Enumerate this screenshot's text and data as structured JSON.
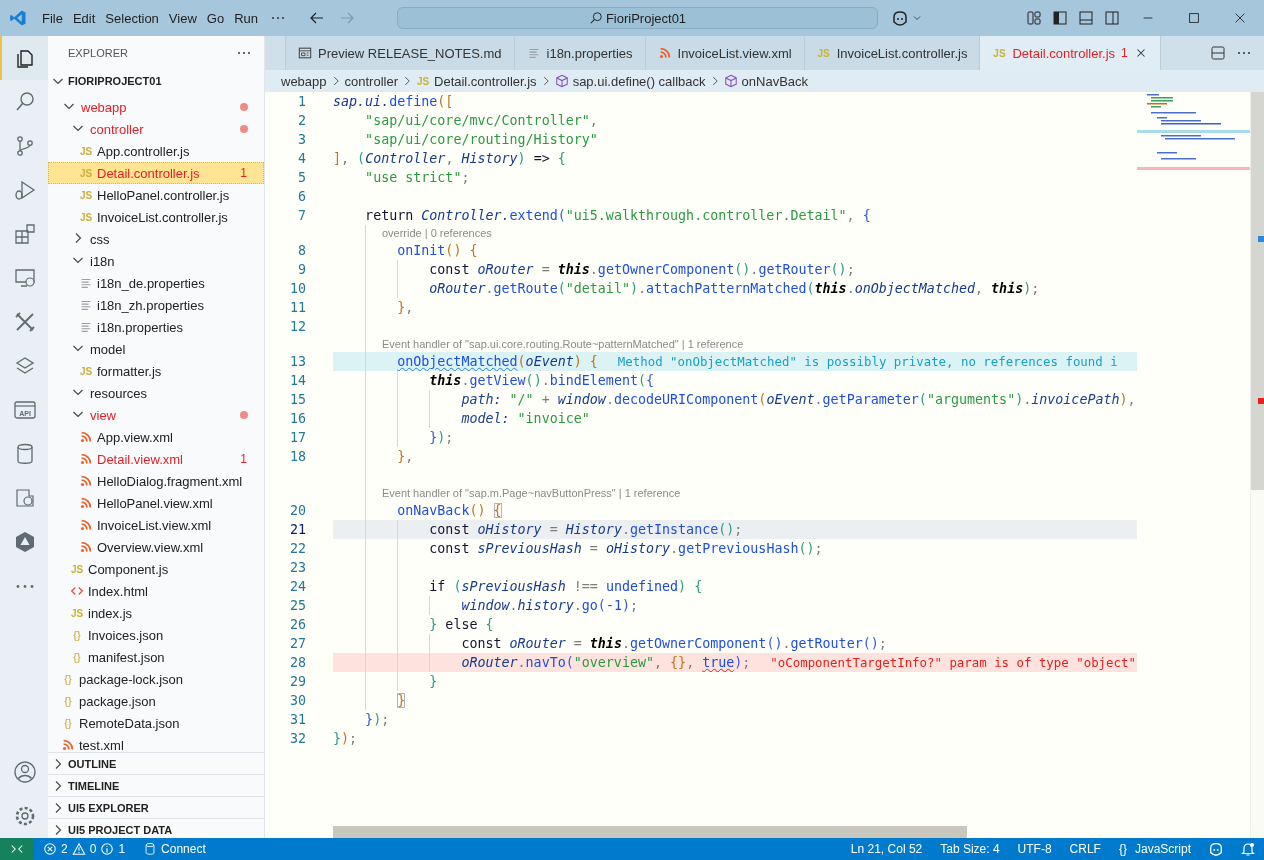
{
  "title_bar": {
    "menu": [
      "File",
      "Edit",
      "Selection",
      "View",
      "Go",
      "Run"
    ],
    "search": "FioriProject01"
  },
  "activity_bar": {
    "items": [
      {
        "kind": "files",
        "selected": true
      },
      {
        "kind": "search",
        "selected": false
      },
      {
        "kind": "source-control",
        "selected": false
      },
      {
        "kind": "run-debug",
        "selected": false
      },
      {
        "kind": "extensions",
        "selected": false
      },
      {
        "kind": "remote",
        "selected": false
      },
      {
        "kind": "tools",
        "selected": false
      },
      {
        "kind": "layers",
        "selected": false
      },
      {
        "kind": "api",
        "label": "API",
        "selected": false
      },
      {
        "kind": "database",
        "selected": false
      },
      {
        "kind": "puzzle",
        "selected": false
      },
      {
        "kind": "hexagon",
        "selected": false
      },
      {
        "kind": "more",
        "selected": false
      }
    ],
    "bottom": [
      {
        "kind": "account",
        "selected": false
      },
      {
        "kind": "settings",
        "selected": false
      }
    ]
  },
  "sidebar": {
    "title": "EXPLORER",
    "project": "FIORIPROJECT01",
    "tree": [
      {
        "name": "webapp",
        "kind": "folder",
        "expanded": true,
        "problem": true,
        "dot": true,
        "selected": false,
        "children": [
          {
            "name": "controller",
            "kind": "folder",
            "expanded": true,
            "problem": true,
            "dot": true,
            "selected": false,
            "children": [
              {
                "name": "App.controller.js",
                "kind": "js",
                "icon": "JS",
                "problem": false,
                "selected": false
              },
              {
                "name": "Detail.controller.js",
                "kind": "js",
                "icon": "JS",
                "problem": true,
                "badge": "1",
                "selected": true
              },
              {
                "name": "HelloPanel.controller.js",
                "kind": "js",
                "icon": "JS",
                "problem": false,
                "selected": false
              },
              {
                "name": "InvoiceList.controller.js",
                "kind": "js",
                "icon": "JS",
                "problem": false,
                "selected": false
              }
            ]
          },
          {
            "name": "css",
            "kind": "folder",
            "expanded": false,
            "problem": false,
            "selected": false
          },
          {
            "name": "i18n",
            "kind": "folder",
            "expanded": true,
            "problem": false,
            "selected": false,
            "children": [
              {
                "name": "i18n_de.properties",
                "kind": "properties",
                "problem": false,
                "selected": false
              },
              {
                "name": "i18n_zh.properties",
                "kind": "properties",
                "problem": false,
                "selected": false
              },
              {
                "name": "i18n.properties",
                "kind": "properties",
                "problem": false,
                "selected": false
              }
            ]
          },
          {
            "name": "model",
            "kind": "folder",
            "expanded": true,
            "problem": false,
            "selected": false,
            "children": [
              {
                "name": "formatter.js",
                "kind": "js",
                "icon": "JS",
                "problem": false,
                "selected": false
              }
            ]
          },
          {
            "name": "resources",
            "kind": "folder",
            "expanded": true,
            "problem": false,
            "selected": false
          },
          {
            "name": "view",
            "kind": "folder",
            "expanded": true,
            "problem": true,
            "dot": true,
            "selected": false,
            "children": [
              {
                "name": "App.view.xml",
                "kind": "xml",
                "problem": false,
                "selected": false
              },
              {
                "name": "Detail.view.xml",
                "kind": "xml",
                "problem": true,
                "badge": "1",
                "selected": false
              },
              {
                "name": "HelloDialog.fragment.xml",
                "kind": "xml",
                "problem": false,
                "selected": false
              },
              {
                "name": "HelloPanel.view.xml",
                "kind": "xml",
                "problem": false,
                "selected": false
              },
              {
                "name": "InvoiceList.view.xml",
                "kind": "xml",
                "problem": false,
                "selected": false
              },
              {
                "name": "Overview.view.xml",
                "kind": "xml",
                "problem": false,
                "selected": false
              }
            ]
          },
          {
            "name": "Component.js",
            "kind": "js",
            "icon": "JS",
            "problem": false,
            "selected": false
          },
          {
            "name": "Index.html",
            "kind": "html",
            "problem": false,
            "selected": false
          },
          {
            "name": "index.js",
            "kind": "js",
            "icon": "JS",
            "problem": false,
            "selected": false
          },
          {
            "name": "Invoices.json",
            "kind": "json",
            "icon": "{}",
            "problem": false,
            "selected": false
          },
          {
            "name": "manifest.json",
            "kind": "json",
            "icon": "{}",
            "problem": false,
            "selected": false
          }
        ]
      },
      {
        "name": "package-lock.json",
        "kind": "json",
        "icon": "{}",
        "problem": false,
        "selected": false
      },
      {
        "name": "package.json",
        "kind": "json",
        "icon": "{}",
        "problem": false,
        "selected": false
      },
      {
        "name": "RemoteData.json",
        "kind": "json",
        "icon": "{}",
        "problem": false,
        "selected": false
      },
      {
        "name": "test.xml",
        "kind": "xml",
        "problem": false,
        "selected": false
      }
    ],
    "sections": [
      "OUTLINE",
      "TIMELINE",
      "UI5 EXPLORER",
      "UI5 PROJECT DATA"
    ]
  },
  "tabs": [
    {
      "label": "Preview RELEASE_NOTES.md",
      "kind": "preview",
      "selected": false,
      "problem": false
    },
    {
      "label": "i18n.properties",
      "kind": "properties",
      "selected": false,
      "problem": false
    },
    {
      "label": "InvoiceList.view.xml",
      "kind": "xml",
      "selected": false,
      "problem": false
    },
    {
      "label": "InvoiceList.controller.js",
      "kind": "js",
      "icon": "JS",
      "selected": false,
      "problem": false
    },
    {
      "label": "Detail.controller.js",
      "kind": "js",
      "icon": "JS",
      "selected": true,
      "problem": true,
      "badge": "1"
    }
  ],
  "breadcrumb": [
    {
      "label": "webapp",
      "kind": "folder"
    },
    {
      "label": "controller",
      "kind": "folder"
    },
    {
      "label": "Detail.controller.js",
      "kind": "js",
      "icon": "JS"
    },
    {
      "label": "sap.ui.define() callback",
      "kind": "symbol"
    },
    {
      "label": "onNavBack",
      "kind": "symbol"
    }
  ],
  "editor": {
    "rows": [
      {
        "kind": "code",
        "number": "1",
        "tokens": [
          {
            "text": "sap.ui.",
            "kind": "var"
          },
          {
            "text": "define",
            "kind": "fn"
          },
          {
            "text": "([",
            "kind": "b1"
          }
        ]
      },
      {
        "kind": "code",
        "number": "2",
        "tokens": [
          {
            "text": "    \"sap/ui/core/mvc/Controller\"",
            "kind": "str"
          },
          {
            "text": ",",
            "kind": "op"
          }
        ]
      },
      {
        "kind": "code",
        "number": "3",
        "tokens": [
          {
            "text": "    \"sap/ui/core/routing/History\"",
            "kind": "str"
          }
        ]
      },
      {
        "kind": "code",
        "number": "4",
        "tokens": [
          {
            "text": "]",
            "kind": "b1"
          },
          {
            "text": ", ",
            "kind": "op"
          },
          {
            "text": "(",
            "kind": "b2"
          },
          {
            "text": "Controller",
            "kind": "var"
          },
          {
            "text": ", ",
            "kind": "op"
          },
          {
            "text": "History",
            "kind": "var"
          },
          {
            "text": ")",
            "kind": "b2"
          },
          {
            "text": " => ",
            "kind": "kw"
          },
          {
            "text": "{",
            "kind": "b2"
          }
        ]
      },
      {
        "kind": "code",
        "number": "5",
        "tokens": [
          {
            "text": "    \"use strict\"",
            "kind": "str"
          },
          {
            "text": ";",
            "kind": "op"
          }
        ]
      },
      {
        "kind": "code",
        "number": "6",
        "tokens": []
      },
      {
        "kind": "code",
        "number": "7",
        "tokens": [
          {
            "text": "    return ",
            "kind": "kw"
          },
          {
            "text": "Controller.",
            "kind": "var"
          },
          {
            "text": "extend",
            "kind": "fn"
          },
          {
            "text": "(",
            "kind": "b3"
          },
          {
            "text": "\"ui5.walkthrough.controller.Detail\"",
            "kind": "str"
          },
          {
            "text": ", ",
            "kind": "op"
          },
          {
            "text": "{",
            "kind": "b3"
          }
        ]
      },
      {
        "kind": "lens",
        "text": "override | 0 references"
      },
      {
        "kind": "code",
        "number": "8",
        "tokens": [
          {
            "text": "        onInit",
            "kind": "fn"
          },
          {
            "text": "() {",
            "kind": "b1"
          }
        ]
      },
      {
        "kind": "code",
        "number": "9",
        "tokens": [
          {
            "text": "            const ",
            "kind": "kw"
          },
          {
            "text": "oRouter",
            "kind": "var"
          },
          {
            "text": " = ",
            "kind": "op"
          },
          {
            "text": "this",
            "kind": "this"
          },
          {
            "text": ".",
            "kind": "op"
          },
          {
            "text": "getOwnerComponent",
            "kind": "fn"
          },
          {
            "text": "()",
            "kind": "b2"
          },
          {
            "text": ".",
            "kind": "op"
          },
          {
            "text": "getRouter",
            "kind": "fn"
          },
          {
            "text": "()",
            "kind": "b2"
          },
          {
            "text": ";",
            "kind": "op"
          }
        ]
      },
      {
        "kind": "code",
        "number": "10",
        "tokens": [
          {
            "text": "            oRouter",
            "kind": "var"
          },
          {
            "text": ".",
            "kind": "op"
          },
          {
            "text": "getRoute",
            "kind": "fn"
          },
          {
            "text": "(",
            "kind": "b2"
          },
          {
            "text": "\"detail\"",
            "kind": "str"
          },
          {
            "text": ")",
            "kind": "b2"
          },
          {
            "text": ".",
            "kind": "op"
          },
          {
            "text": "attachPatternMatched",
            "kind": "fn"
          },
          {
            "text": "(",
            "kind": "b2"
          },
          {
            "text": "this",
            "kind": "this"
          },
          {
            "text": ".",
            "kind": "op"
          },
          {
            "text": "onObjectMatched",
            "kind": "var"
          },
          {
            "text": ", ",
            "kind": "op"
          },
          {
            "text": "this",
            "kind": "this"
          },
          {
            "text": ")",
            "kind": "b2"
          },
          {
            "text": ";",
            "kind": "op"
          }
        ]
      },
      {
        "kind": "code",
        "number": "11",
        "tokens": [
          {
            "text": "        }",
            "kind": "b1"
          },
          {
            "text": ",",
            "kind": "op"
          }
        ]
      },
      {
        "kind": "code",
        "number": "12",
        "tokens": []
      },
      {
        "kind": "lens",
        "text": "Event handler of \"sap.ui.core.routing.Route~patternMatched\" | 1 reference"
      },
      {
        "kind": "code",
        "number": "13",
        "tokens": [
          {
            "text": "        onObjectMatched",
            "kind": "fn",
            "squiggle": true
          },
          {
            "text": "(",
            "kind": "b1"
          },
          {
            "text": "oEvent",
            "kind": "var"
          },
          {
            "text": ") {",
            "kind": "b1"
          }
        ],
        "hint": {
          "text": "Method \"onObjectMatched\" is possibly private, no references found i",
          "kind": "info"
        }
      },
      {
        "kind": "code",
        "number": "14",
        "tokens": [
          {
            "text": "            this",
            "kind": "this"
          },
          {
            "text": ".",
            "kind": "op"
          },
          {
            "text": "getView",
            "kind": "fn"
          },
          {
            "text": "()",
            "kind": "b2"
          },
          {
            "text": ".",
            "kind": "op"
          },
          {
            "text": "bindElement",
            "kind": "fn"
          },
          {
            "text": "(",
            "kind": "b2"
          },
          {
            "text": "{",
            "kind": "b3"
          }
        ]
      },
      {
        "kind": "code",
        "number": "15",
        "tokens": [
          {
            "text": "                path: ",
            "kind": "prop"
          },
          {
            "text": "\"/\"",
            "kind": "str"
          },
          {
            "text": " + ",
            "kind": "op"
          },
          {
            "text": "window",
            "kind": "var"
          },
          {
            "text": ".",
            "kind": "op"
          },
          {
            "text": "decodeURIComponent",
            "kind": "fn"
          },
          {
            "text": "(",
            "kind": "b1"
          },
          {
            "text": "oEvent",
            "kind": "var"
          },
          {
            "text": ".",
            "kind": "op"
          },
          {
            "text": "getParameter",
            "kind": "fn"
          },
          {
            "text": "(",
            "kind": "b2"
          },
          {
            "text": "\"arguments\"",
            "kind": "str"
          },
          {
            "text": ")",
            "kind": "b2"
          },
          {
            "text": ".",
            "kind": "op"
          },
          {
            "text": "invoicePath",
            "kind": "prop"
          },
          {
            "text": ")",
            "kind": "b1"
          },
          {
            "text": ",",
            "kind": "op"
          }
        ]
      },
      {
        "kind": "code",
        "number": "16",
        "tokens": [
          {
            "text": "                model: ",
            "kind": "prop"
          },
          {
            "text": "\"invoice\"",
            "kind": "str"
          }
        ]
      },
      {
        "kind": "code",
        "number": "17",
        "tokens": [
          {
            "text": "            }",
            "kind": "b3"
          },
          {
            "text": ")",
            "kind": "b2"
          },
          {
            "text": ";",
            "kind": "op"
          }
        ]
      },
      {
        "kind": "code",
        "number": "18",
        "tokens": [
          {
            "text": "        }",
            "kind": "b1"
          },
          {
            "text": ",",
            "kind": "op"
          }
        ]
      },
      {
        "kind": "code",
        "tokens": []
      },
      {
        "kind": "lens",
        "text": "Event handler of \"sap.m.Page~navButtonPress\" | 1 reference"
      },
      {
        "kind": "code",
        "number": "20",
        "tokens": [
          {
            "text": "        onNavBack",
            "kind": "fn"
          },
          {
            "text": "() ",
            "kind": "b1"
          },
          {
            "text": "{",
            "kind": "b1",
            "matched": true
          }
        ]
      },
      {
        "kind": "code",
        "number": "21",
        "current": true,
        "tokens": [
          {
            "text": "            const ",
            "kind": "kw"
          },
          {
            "text": "oHistory",
            "kind": "var"
          },
          {
            "text": " = ",
            "kind": "op"
          },
          {
            "text": "History",
            "kind": "var"
          },
          {
            "text": ".",
            "kind": "op"
          },
          {
            "text": "getInstance",
            "kind": "fn"
          },
          {
            "text": "()",
            "kind": "b2"
          },
          {
            "text": ";",
            "kind": "op"
          }
        ]
      },
      {
        "kind": "code",
        "number": "22",
        "tokens": [
          {
            "text": "            const ",
            "kind": "kw"
          },
          {
            "text": "sPreviousHash",
            "kind": "var"
          },
          {
            "text": " = ",
            "kind": "op"
          },
          {
            "text": "oHistory",
            "kind": "var"
          },
          {
            "text": ".",
            "kind": "op"
          },
          {
            "text": "getPreviousHash",
            "kind": "fn"
          },
          {
            "text": "()",
            "kind": "b2"
          },
          {
            "text": ";",
            "kind": "op"
          }
        ]
      },
      {
        "kind": "code",
        "number": "23",
        "tokens": []
      },
      {
        "kind": "code",
        "number": "24",
        "tokens": [
          {
            "text": "            if ",
            "kind": "kw"
          },
          {
            "text": "(",
            "kind": "b2"
          },
          {
            "text": "sPreviousHash",
            "kind": "var"
          },
          {
            "text": " !== ",
            "kind": "op"
          },
          {
            "text": "undefined",
            "kind": "lit"
          },
          {
            "text": ") {",
            "kind": "b2"
          }
        ]
      },
      {
        "kind": "code",
        "number": "25",
        "tokens": [
          {
            "text": "                window",
            "kind": "var"
          },
          {
            "text": ".",
            "kind": "op"
          },
          {
            "text": "history",
            "kind": "var"
          },
          {
            "text": ".",
            "kind": "op"
          },
          {
            "text": "go",
            "kind": "fn"
          },
          {
            "text": "(",
            "kind": "b3"
          },
          {
            "text": "-1",
            "kind": "lit"
          },
          {
            "text": ")",
            "kind": "b3"
          },
          {
            "text": ";",
            "kind": "op"
          }
        ]
      },
      {
        "kind": "code",
        "number": "26",
        "tokens": [
          {
            "text": "            } ",
            "kind": "b2"
          },
          {
            "text": "else ",
            "kind": "kw"
          },
          {
            "text": "{",
            "kind": "b2"
          }
        ]
      },
      {
        "kind": "code",
        "number": "27",
        "tokens": [
          {
            "text": "                const ",
            "kind": "kw"
          },
          {
            "text": "oRouter",
            "kind": "var"
          },
          {
            "text": " = ",
            "kind": "op"
          },
          {
            "text": "this",
            "kind": "this"
          },
          {
            "text": ".",
            "kind": "op"
          },
          {
            "text": "getOwnerComponent",
            "kind": "fn"
          },
          {
            "text": "()",
            "kind": "b3"
          },
          {
            "text": ".",
            "kind": "op"
          },
          {
            "text": "getRouter",
            "kind": "fn"
          },
          {
            "text": "()",
            "kind": "b3"
          },
          {
            "text": ";",
            "kind": "op"
          }
        ]
      },
      {
        "kind": "code",
        "number": "28",
        "tokens": [
          {
            "text": "                oRouter",
            "kind": "var"
          },
          {
            "text": ".",
            "kind": "op"
          },
          {
            "text": "navTo",
            "kind": "fn"
          },
          {
            "text": "(",
            "kind": "b3"
          },
          {
            "text": "\"overview\"",
            "kind": "str"
          },
          {
            "text": ", ",
            "kind": "op"
          },
          {
            "text": "{}",
            "kind": "b1"
          },
          {
            "text": ", ",
            "kind": "op"
          },
          {
            "text": "true",
            "kind": "lit",
            "squiggle": true
          },
          {
            "text": ")",
            "kind": "b3"
          },
          {
            "text": ";",
            "kind": "op"
          }
        ],
        "hint": {
          "text": "\"oComponentTargetInfo?\" param is of type \"object\"",
          "kind": "error"
        }
      },
      {
        "kind": "code",
        "number": "29",
        "tokens": [
          {
            "text": "            }",
            "kind": "b2"
          }
        ]
      },
      {
        "kind": "code",
        "number": "30",
        "tokens": [
          {
            "text": "        }",
            "kind": "b1",
            "matched": true
          }
        ]
      },
      {
        "kind": "code",
        "number": "31",
        "tokens": [
          {
            "text": "    }",
            "kind": "b3"
          },
          {
            "text": ")",
            "kind": "b2"
          },
          {
            "text": ";",
            "kind": "op"
          }
        ]
      },
      {
        "kind": "code",
        "number": "32",
        "tokens": [
          {
            "text": "}",
            "kind": "b2"
          },
          {
            "text": ")",
            "kind": "b1"
          },
          {
            "text": ";",
            "kind": "op"
          }
        ]
      }
    ]
  },
  "status_bar": {
    "problems": {
      "errors": "2",
      "warnings": "0",
      "infos": "1"
    },
    "connect": "Connect",
    "items": [
      "Ln 21, Col 52",
      "Tab Size: 4",
      "UTF-8",
      "CRLF"
    ],
    "language": {
      "icon": "{}",
      "label": "JavaScript"
    }
  }
}
